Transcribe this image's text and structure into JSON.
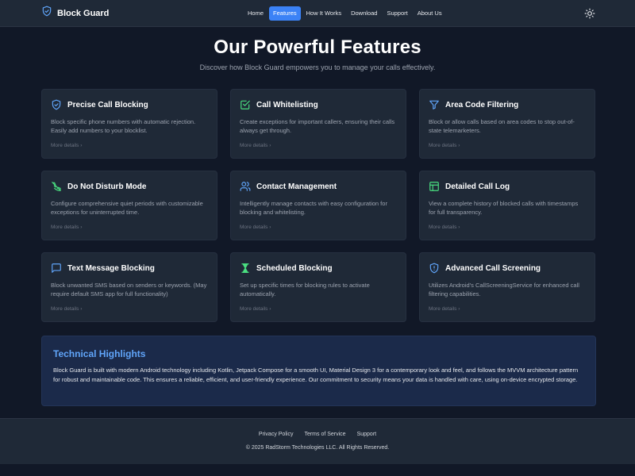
{
  "header": {
    "brand": "Block Guard",
    "nav": [
      {
        "label": "Home",
        "active": false
      },
      {
        "label": "Features",
        "active": true
      },
      {
        "label": "How It Works",
        "active": false
      },
      {
        "label": "Download",
        "active": false
      },
      {
        "label": "Support",
        "active": false
      },
      {
        "label": "About Us",
        "active": false
      }
    ],
    "theme_toggle_icon": "sun-icon"
  },
  "hero": {
    "title": "Our Powerful Features",
    "subtitle": "Discover how Block Guard empowers you to manage your calls effectively."
  },
  "features": [
    {
      "icon": "shield-check-icon",
      "title": "Precise Call Blocking",
      "desc": "Block specific phone numbers with automatic rejection. Easily add numbers to your blocklist.",
      "more": "More details"
    },
    {
      "icon": "checkbox-icon",
      "title": "Call Whitelisting",
      "desc": "Create exceptions for important callers, ensuring their calls always get through.",
      "more": "More details"
    },
    {
      "icon": "filter-icon",
      "title": "Area Code Filtering",
      "desc": "Block or allow calls based on area codes to stop out-of-state telemarketers.",
      "more": "More details"
    },
    {
      "icon": "phone-off-icon",
      "title": "Do Not Disturb Mode",
      "desc": "Configure comprehensive quiet periods with customizable exceptions for uninterrupted time.",
      "more": "More details"
    },
    {
      "icon": "users-icon",
      "title": "Contact Management",
      "desc": "Intelligently manage contacts with easy configuration for blocking and whitelisting.",
      "more": "More details"
    },
    {
      "icon": "table-icon",
      "title": "Detailed Call Log",
      "desc": "View a complete history of blocked calls with timestamps for full transparency.",
      "more": "More details"
    },
    {
      "icon": "message-icon",
      "title": "Text Message Blocking",
      "desc": "Block unwanted SMS based on senders or keywords. (May require default SMS app for full functionality)",
      "more": "More details"
    },
    {
      "icon": "hourglass-icon",
      "title": "Scheduled Blocking",
      "desc": "Set up specific times for blocking rules to activate automatically.",
      "more": "More details"
    },
    {
      "icon": "shield-alert-icon",
      "title": "Advanced Call Screening",
      "desc": "Utilizes Android's CallScreeningService for enhanced call filtering capabilities.",
      "more": "More details"
    }
  ],
  "tech": {
    "title": "Technical Highlights",
    "body": "Block Guard is built with modern Android technology including Kotlin, Jetpack Compose for a smooth UI, Material Design 3 for a contemporary look and feel, and follows the MVVM architecture pattern for robust and maintainable code. This ensures a reliable, efficient, and user-friendly experience. Our commitment to security means your data is handled with care, using on-device encrypted storage."
  },
  "footer": {
    "links": [
      "Privacy Policy",
      "Terms of Service",
      "Support"
    ],
    "copyright": "© 2025 RadStorm Technologies LLC. All Rights Reserved."
  },
  "colors": {
    "background": "#111827",
    "surface": "#1f2937",
    "accent": "#3b82f6",
    "highlight_title": "#60a5fa",
    "icon_blue": "#60a5fa",
    "icon_green": "#4ade80"
  }
}
